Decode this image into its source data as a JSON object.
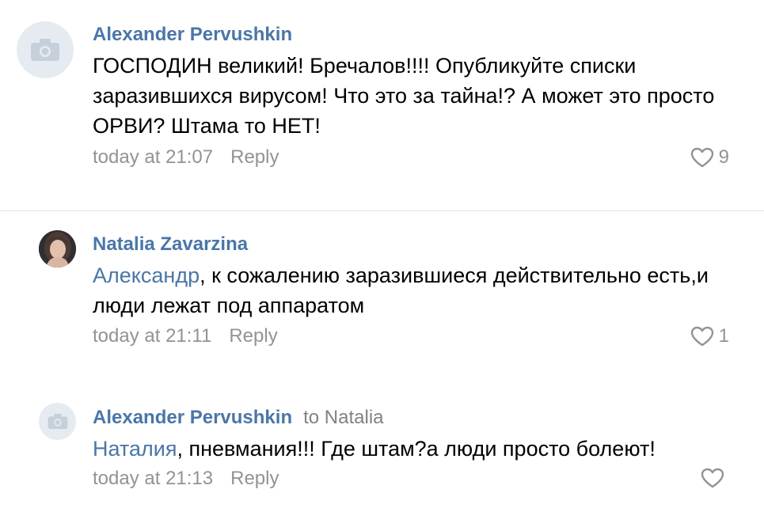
{
  "comments": [
    {
      "author": "Alexander Pervushkin",
      "reply_to": "",
      "mention": "",
      "text": "ГОСПОДИН великий! Бречалов!!!! Опубликуйте списки заразившихся вирусом! Что это за тайна!? А может это просто ОРВИ? Штама то НЕТ!",
      "time": "today at 21:07",
      "reply_label": "Reply",
      "likes": "9"
    },
    {
      "author": "Natalia Zavarzina",
      "reply_to": "",
      "mention": "Александр",
      "text": ", к сожалению  заразившиеся действительно есть,и люди лежат под аппаратом",
      "time": "today at 21:11",
      "reply_label": "Reply",
      "likes": "1"
    },
    {
      "author": "Alexander Pervushkin",
      "reply_to": "to Natalia",
      "mention": "Наталия",
      "text": ", пневмания!!! Где штам?а люди просто болеют!",
      "time": "today at 21:13",
      "reply_label": "Reply",
      "likes": ""
    }
  ],
  "icons": {
    "camera": "camera-icon",
    "heart": "heart-icon"
  },
  "colors": {
    "link": "#4a76a8",
    "meta": "#939393",
    "avatar_placeholder": "#e5ebf1"
  }
}
